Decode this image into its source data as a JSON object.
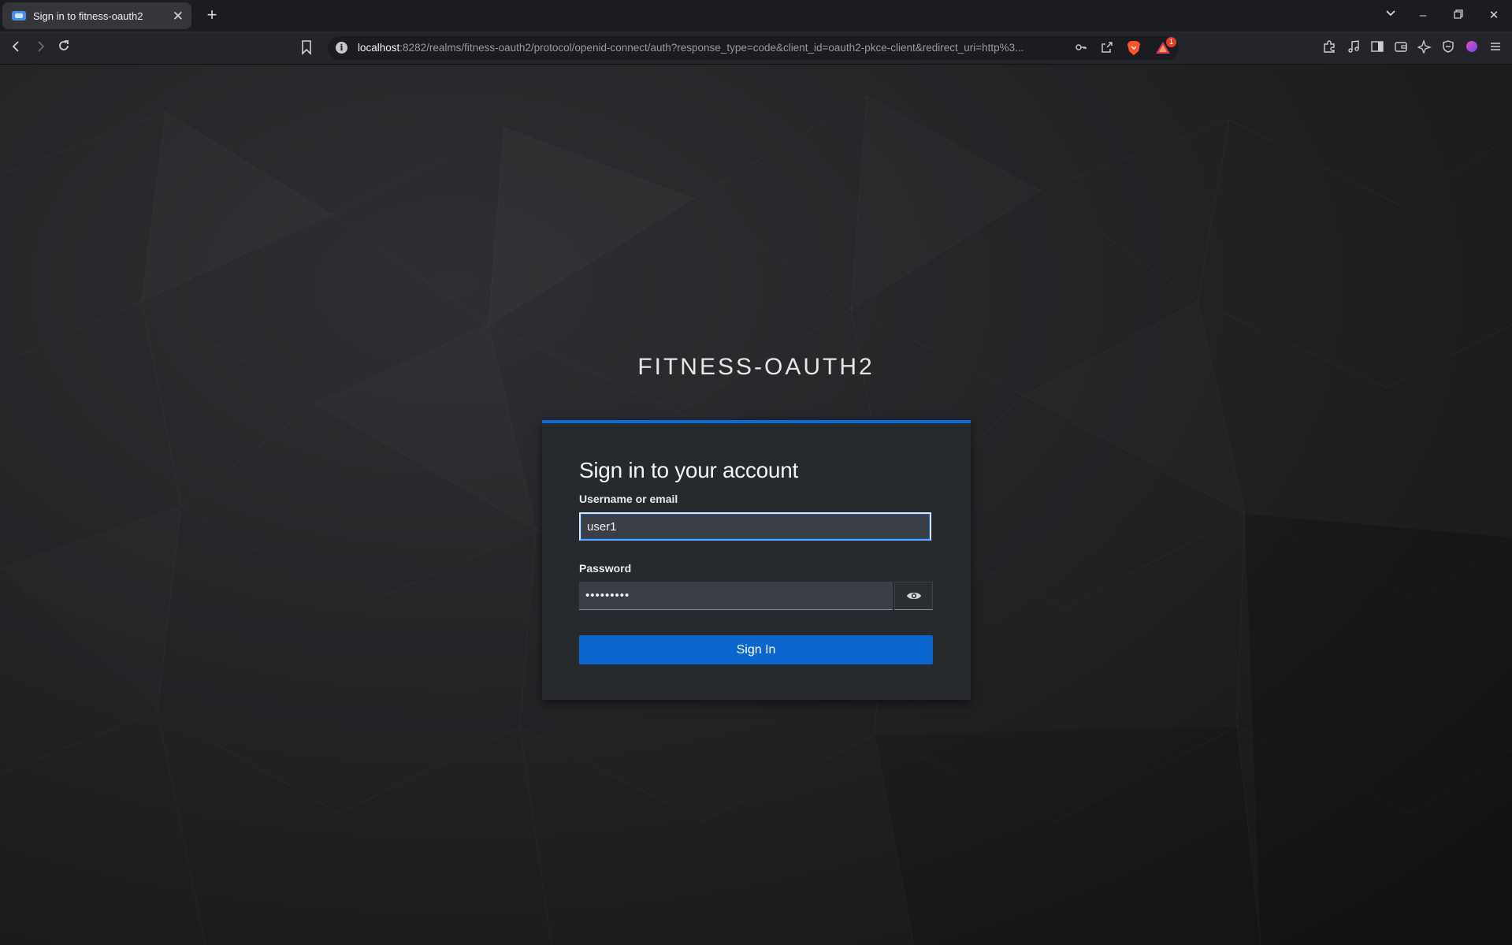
{
  "browser": {
    "tab": {
      "title": "Sign in to fitness-oauth2",
      "close": "✕"
    },
    "new_tab": "+",
    "window_controls": {
      "list": "⌄",
      "minimize": "–",
      "restore": "❐",
      "close": "✕"
    },
    "url": {
      "host": "localhost",
      "rest": ":8282/realms/fitness-oauth2/protocol/openid-connect/auth?response_type=code&client_id=oauth2-pkce-client&redirect_uri=http%3..."
    },
    "info_icon": "i",
    "shields_badge": "1",
    "icons": {
      "back": "back-icon",
      "forward": "forward-icon",
      "reload": "reload-icon",
      "bookmark": "bookmark-icon",
      "key": "key-icon",
      "share": "share-icon",
      "brave_shields": "brave-shields-icon",
      "brave_rewards": "brave-rewards-icon",
      "extensions": "extensions-icon",
      "media": "music-note-icon",
      "sidebar": "sidebar-icon",
      "wallet": "wallet-icon",
      "leo": "leo-ai-icon",
      "vpn": "vpn-shield-icon",
      "profile": "profile-icon",
      "menu": "menu-icon"
    }
  },
  "login": {
    "realm_title": "FITNESS-OAUTH2",
    "heading": "Sign in to your account",
    "username_label": "Username or email",
    "username_value": "user1",
    "password_label": "Password",
    "password_value": "•••••••••",
    "submit_label": "Sign In"
  },
  "colors": {
    "accent": "#0a66cc",
    "card": "#26292d",
    "input": "#3a3f47"
  }
}
